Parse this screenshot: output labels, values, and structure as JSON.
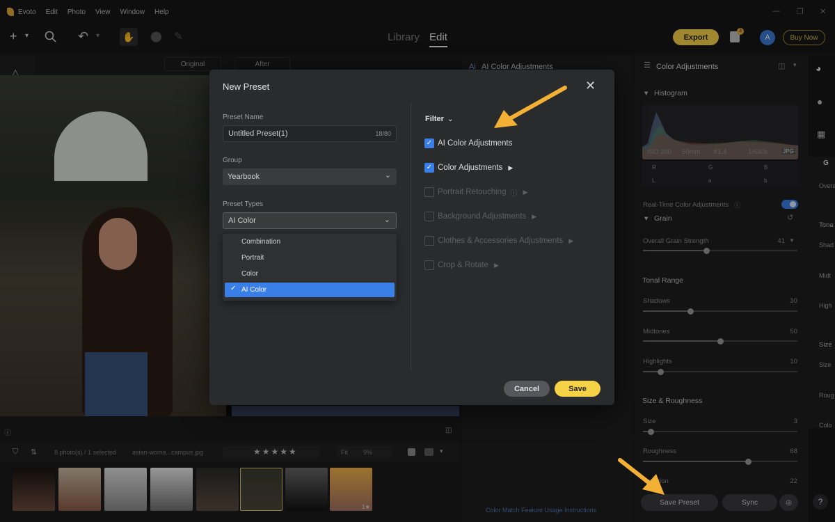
{
  "app": {
    "name": "Evoto",
    "menu": [
      "Edit",
      "Photo",
      "View",
      "Window",
      "Help"
    ]
  },
  "toolbar": {
    "tabs": [
      {
        "label": "Library"
      },
      {
        "label": "Edit"
      }
    ],
    "export_label": "Export",
    "avatar_letter": "A",
    "buy_now_label": "Buy Now",
    "badge": "3"
  },
  "canvas": {
    "original_label": "Original",
    "after_label": "After"
  },
  "filmstrip": {
    "status": "8 photo(s) / 1 selected",
    "filename": "asian-woma...campus.jpg",
    "fit_label": "Fit",
    "zoom": "9%",
    "thumb_rating": "1★"
  },
  "mid_panel": {
    "title": "AI Color Adjustments",
    "footer_link": "Color Match Feature Usage Instructions"
  },
  "right_panel": {
    "title": "Color Adjustments",
    "histogram_label": "Histogram",
    "exif": [
      "ISO 200",
      "50mm",
      "f/1.4",
      "1/640s",
      "JPG"
    ],
    "rgb_labels": [
      "R",
      "G",
      "B",
      "L",
      "a",
      "b"
    ],
    "realtime_label": "Real-Time Color Adjustments",
    "grain_label": "Grain",
    "overall_grain_label": "Overall Grain Strength",
    "overall_grain_value": "41",
    "tonal_range_label": "Tonal Range",
    "shadows_label": "Shadows",
    "shadows_value": "30",
    "midtones_label": "Midtones",
    "midtones_value": "50",
    "highlights_label": "Highlights",
    "highlights_value": "10",
    "size_roughness_label": "Size & Roughness",
    "size_label": "Size",
    "size_value": "3",
    "roughness_label": "Roughness",
    "roughness_value": "68",
    "variation_label": "Variation",
    "variation_value": "22",
    "save_preset_label": "Save Preset",
    "sync_label": "Sync"
  },
  "far_right": {
    "overall_label": "Overa",
    "tonal_label": "Tona",
    "shad_label": "Shad",
    "midt_label": "Midt",
    "high_label": "High",
    "size_label": "Size",
    "size2_label": "Size",
    "roug_label": "Roug",
    "colo_label": "Colo",
    "g_label": "G"
  },
  "modal": {
    "title": "New Preset",
    "preset_name_label": "Preset Name",
    "preset_name_value": "Untitled Preset(1)",
    "preset_name_counter": "18/80",
    "group_label": "Group",
    "group_value": "Yearbook",
    "preset_types_label": "Preset Types",
    "preset_type_value": "AI Color",
    "preset_type_options": [
      "Combination",
      "Portrait",
      "Color",
      "AI Color"
    ],
    "filter_label": "Filter",
    "filter_items": [
      {
        "label": "AI Color Adjustments",
        "checked": true
      },
      {
        "label": "Color Adjustments",
        "checked": true
      },
      {
        "label": "Portrait Retouching",
        "checked": false
      },
      {
        "label": "Background Adjustments",
        "checked": false
      },
      {
        "label": "Clothes & Accessories Adjustments",
        "checked": false
      },
      {
        "label": "Crop & Rotate",
        "checked": false
      }
    ],
    "cancel_label": "Cancel",
    "save_label": "Save"
  },
  "colors": {
    "accent_yellow": "#f6d247",
    "selection_blue": "#3a7ee8",
    "arrow_orange": "#f2b134"
  }
}
